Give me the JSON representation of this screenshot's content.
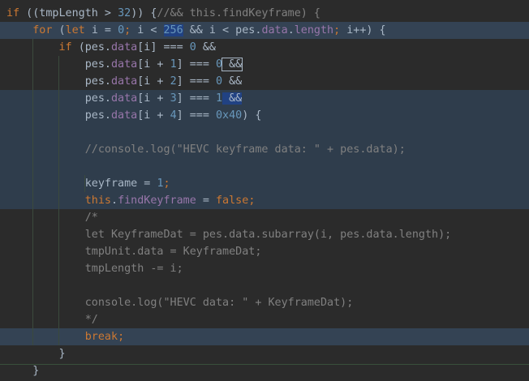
{
  "editor": {
    "language": "javascript",
    "colors": {
      "background": "#2b2b2b",
      "line_highlight": "#344354",
      "keyword": "#cc7832",
      "number": "#6897bb",
      "property": "#9876aa",
      "comment": "#808080",
      "text": "#a9b7c6"
    },
    "lines": [
      {
        "highlight": "none",
        "tokens": [
          {
            "t": "if",
            "c": "kw"
          },
          {
            "t": " ((tmpLength > ",
            "c": "tx"
          },
          {
            "t": "32",
            "c": "num"
          },
          {
            "t": ")) {",
            "c": "tx"
          },
          {
            "t": "//&& this.findKeyframe) {",
            "c": "cm"
          }
        ]
      },
      {
        "highlight": "hl",
        "tokens": [
          {
            "t": "    for ",
            "c": "kw"
          },
          {
            "t": "(",
            "c": "tx"
          },
          {
            "t": "let ",
            "c": "kw"
          },
          {
            "t": "i = ",
            "c": "tx"
          },
          {
            "t": "0",
            "c": "num"
          },
          {
            "t": "; ",
            "c": "kw"
          },
          {
            "t": "i < ",
            "c": "tx"
          },
          {
            "t": "256",
            "c": "num",
            "box": "sel"
          },
          {
            "t": " && i < pes.",
            "c": "tx"
          },
          {
            "t": "data",
            "c": "prop"
          },
          {
            "t": ".",
            "c": "tx"
          },
          {
            "t": "length",
            "c": "prop"
          },
          {
            "t": "; ",
            "c": "kw"
          },
          {
            "t": "i++) {",
            "c": "tx"
          }
        ]
      },
      {
        "highlight": "none",
        "tokens": [
          {
            "t": "        if ",
            "c": "kw"
          },
          {
            "t": "(pes.",
            "c": "tx"
          },
          {
            "t": "data",
            "c": "prop"
          },
          {
            "t": "[i] === ",
            "c": "tx"
          },
          {
            "t": "0",
            "c": "num"
          },
          {
            "t": " &&",
            "c": "tx"
          }
        ]
      },
      {
        "highlight": "none",
        "tokens": [
          {
            "t": "            pes.",
            "c": "tx"
          },
          {
            "t": "data",
            "c": "prop"
          },
          {
            "t": "[i + ",
            "c": "tx"
          },
          {
            "t": "1",
            "c": "num"
          },
          {
            "t": "] === ",
            "c": "tx"
          },
          {
            "t": "0",
            "c": "num"
          },
          {
            "t": " &&",
            "c": "tx",
            "box": "caret"
          }
        ]
      },
      {
        "highlight": "none",
        "tokens": [
          {
            "t": "            pes.",
            "c": "tx"
          },
          {
            "t": "data",
            "c": "prop"
          },
          {
            "t": "[i + ",
            "c": "tx"
          },
          {
            "t": "2",
            "c": "num"
          },
          {
            "t": "] === ",
            "c": "tx"
          },
          {
            "t": "0",
            "c": "num"
          },
          {
            "t": " &&",
            "c": "tx"
          }
        ]
      },
      {
        "highlight": "hl-dark",
        "tokens": [
          {
            "t": "            pes.",
            "c": "tx"
          },
          {
            "t": "data",
            "c": "prop"
          },
          {
            "t": "[i + ",
            "c": "tx"
          },
          {
            "t": "3",
            "c": "num"
          },
          {
            "t": "] === ",
            "c": "tx"
          },
          {
            "t": "1",
            "c": "num"
          },
          {
            "t": " &&",
            "c": "tx",
            "box": "sel"
          }
        ]
      },
      {
        "highlight": "hl-dark",
        "tokens": [
          {
            "t": "            pes.",
            "c": "tx"
          },
          {
            "t": "data",
            "c": "prop"
          },
          {
            "t": "[i + ",
            "c": "tx"
          },
          {
            "t": "4",
            "c": "num"
          },
          {
            "t": "] === ",
            "c": "tx"
          },
          {
            "t": "0x40",
            "c": "num"
          },
          {
            "t": ") {",
            "c": "tx"
          }
        ]
      },
      {
        "highlight": "hl-dark",
        "tokens": [
          {
            "t": "",
            "c": "tx"
          }
        ]
      },
      {
        "highlight": "hl-dark",
        "tokens": [
          {
            "t": "            //console.log(\"HEVC keyframe data: \" + pes.data);",
            "c": "cm"
          }
        ]
      },
      {
        "highlight": "hl-dark",
        "tokens": [
          {
            "t": "",
            "c": "tx"
          }
        ]
      },
      {
        "highlight": "hl-dark",
        "tokens": [
          {
            "t": "            keyframe = ",
            "c": "tx"
          },
          {
            "t": "1",
            "c": "num"
          },
          {
            "t": ";",
            "c": "kw"
          }
        ]
      },
      {
        "highlight": "hl-dark",
        "tokens": [
          {
            "t": "            ",
            "c": "tx"
          },
          {
            "t": "this",
            "c": "kw"
          },
          {
            "t": ".",
            "c": "tx"
          },
          {
            "t": "findKeyframe",
            "c": "prop"
          },
          {
            "t": " = ",
            "c": "tx"
          },
          {
            "t": "false",
            "c": "kw"
          },
          {
            "t": ";",
            "c": "kw"
          }
        ]
      },
      {
        "highlight": "none",
        "tokens": [
          {
            "t": "            /*",
            "c": "cm"
          }
        ]
      },
      {
        "highlight": "none",
        "tokens": [
          {
            "t": "            let KeyframeDat = pes.data.subarray(i, pes.data.length);",
            "c": "cm"
          }
        ]
      },
      {
        "highlight": "none",
        "tokens": [
          {
            "t": "            tmpUnit.data = KeyframeDat;",
            "c": "cm"
          }
        ]
      },
      {
        "highlight": "none",
        "tokens": [
          {
            "t": "            tmpLength -= i;",
            "c": "cm"
          }
        ]
      },
      {
        "highlight": "none",
        "tokens": [
          {
            "t": "",
            "c": "tx"
          }
        ]
      },
      {
        "highlight": "none",
        "tokens": [
          {
            "t": "            console.log(\"HEVC data: \" + KeyframeDat);",
            "c": "cm"
          }
        ]
      },
      {
        "highlight": "none",
        "tokens": [
          {
            "t": "            */",
            "c": "cm"
          }
        ]
      },
      {
        "highlight": "hl",
        "tokens": [
          {
            "t": "            ",
            "c": "tx"
          },
          {
            "t": "break",
            "c": "kw"
          },
          {
            "t": ";",
            "c": "kw"
          }
        ]
      },
      {
        "highlight": "none",
        "tokens": [
          {
            "t": "        }",
            "c": "tx"
          }
        ]
      },
      {
        "highlight": "none",
        "tokens": [
          {
            "t": "    }",
            "c": "tx"
          }
        ]
      }
    ]
  }
}
